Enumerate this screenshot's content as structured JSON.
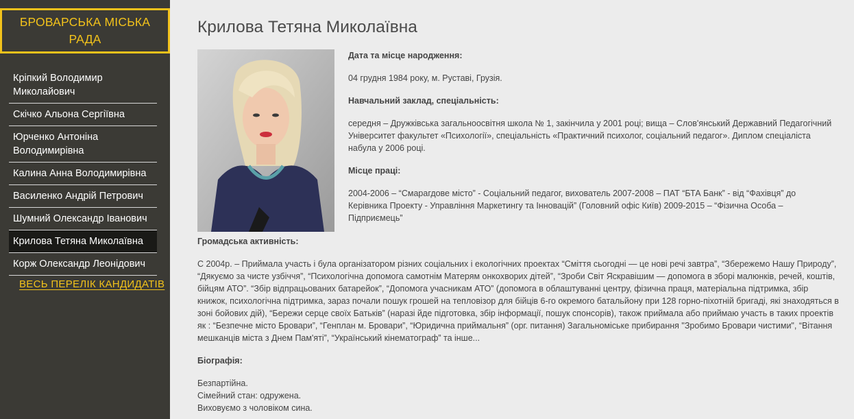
{
  "sidebar": {
    "title": "БРОВАРСЬКА МІСЬКА РАДА",
    "items": [
      {
        "label": "Кріпкий Володимир Миколайович"
      },
      {
        "label": "Скічко Альона Сергіївна"
      },
      {
        "label": "Юрченко Антоніна Володимирівна"
      },
      {
        "label": "Калина Анна Володимирівна"
      },
      {
        "label": "Василенко Андрій Петрович"
      },
      {
        "label": "Шумний Олександр Іванович"
      },
      {
        "label": "Крилова Тетяна Миколаївна"
      },
      {
        "label": "Корж Олександр Леонідович"
      }
    ],
    "active_index": 6,
    "all_link": "ВЕСЬ ПЕРЕЛІК КАНДИДАТІВ"
  },
  "main": {
    "title": "Крилова Тетяна Миколаївна",
    "birth_label": "Дата та місце народження:",
    "birth_value": "04 грудня 1984 року, м. Руставі, Грузія.",
    "education_label": "Навчальний заклад, спеціальність:",
    "education_value": "середня – Дружківська загальноосвітня школа № 1, закінчила у 2001 році; вища – Слов'янський Державний Педагогічний Університет факультет «Психології», спеціальність «Практичний психолог, соціальний педагог». Диплом спеціаліста набула у 2006 році.",
    "work_label": "Місце праці:",
    "work_value": "2004-2006 – “Смарагдове місто” - Соціальний педагог, вихователь 2007-2008 – ПАТ “БТА Банк” - від “Фахівця” до Керівника Проекту - Управління Маркетингу та Інновацій” (Головний офіс Київ) 2009-2015 – “Фізична Особа – Підприємець”",
    "activity_label": "Громадська активність:",
    "activity_value": "С 2004р. – Приймала участь і була організатором різних соціальних і екологічних проектах “Сміття сьогодні — це нові речі завтра”, “Збережемо Нашу Природу”, “Дякуємо за чисте узбіччя”, “Психологічна допомога самотнім Матерям онкохворих дітей”, “Зроби Світ Яскравішим — допомога в зборі малюнків, речей, коштів, бійцям АТО”. “Збір відпрацьованих батарейок”, “Допомога учасникам АТО” (допомога в облаштуванні центру, фізична праця, матеріальна підтримка, збір книжок, психологічна підтримка, зараз почали пошук грошей на тепловізор для бійців 6-го окремого батальйону при 128 горно-піхотній бригаді, які знаходяться в зоні бойових дій), “Бережи серце своїх Батьків” (наразі йде підготовка, збір інформації, пошук спонсорів), також приймала або приймаю участь в таких проектів як : “Безпечне місто Бровари”, “Генплан м. Бровари”, “Юридична приймальня” (орг. питання) Загальноміське прибирання \"Зробимо Бровари чистими\", “Вітання мешканців міста з Днем Пам'яті”, “Український кінематограф” та інше...",
    "bio_label": "Біографія:",
    "bio_lines": [
      "Безпартійна.",
      "Сімейний стан: одружена.",
      "Виховуємо з чоловіком сина."
    ]
  },
  "colors": {
    "sidebar_bg": "#3b3a35",
    "accent": "#f2c21b",
    "page_bg": "#ececec",
    "active_bg": "#1a1a17"
  },
  "icons": {
    "photo": "portrait-photo"
  }
}
